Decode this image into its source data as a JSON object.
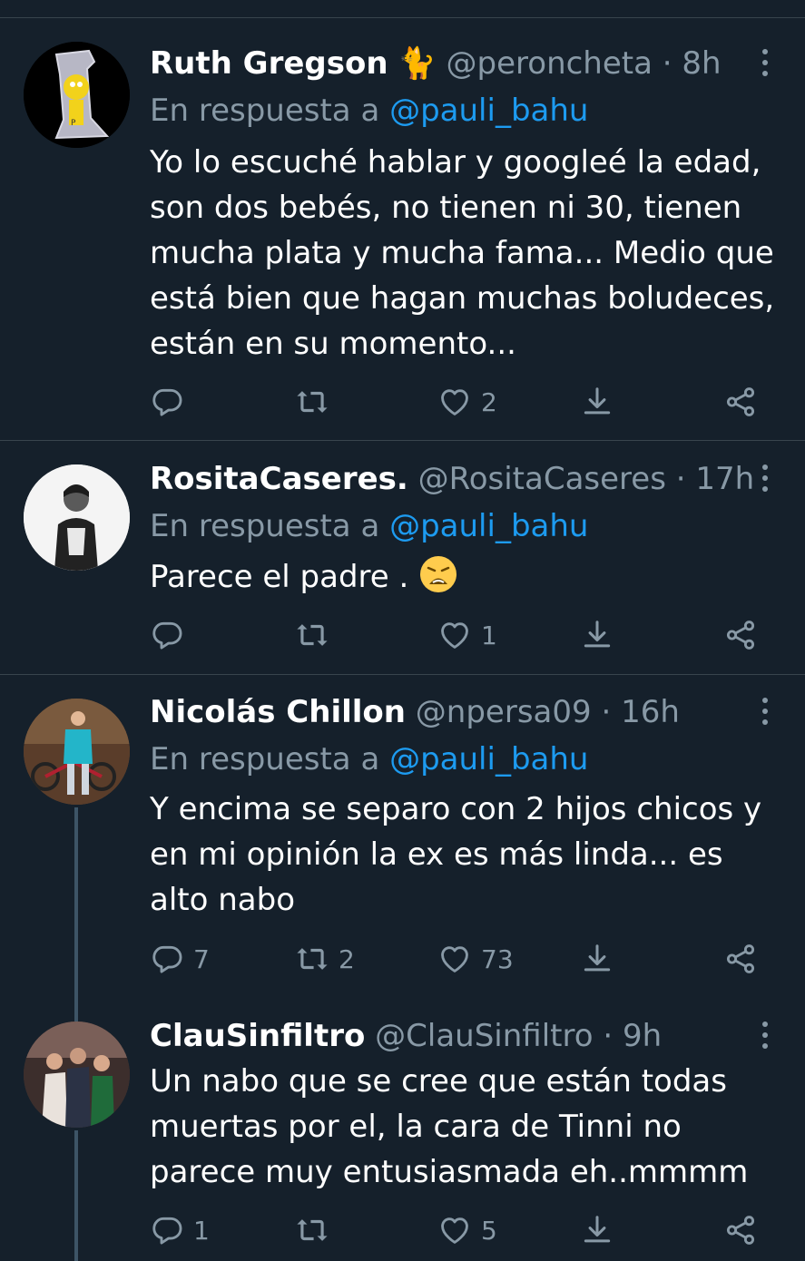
{
  "tweets": [
    {
      "name": "Ruth Gregson",
      "name_emoji": "🐈",
      "handle": "@peroncheta",
      "time": "· 8h",
      "reply_prefix": "En respuesta a",
      "reply_to": "@pauli_bahu",
      "text": "Yo lo escuché hablar y googleé la edad, son dos bebés, no tienen ni 30, tienen mucha plata y mucha fama... Medio que está bien que hagan muchas boludeces, están en su momento...",
      "replies": "",
      "retweets": "",
      "likes": "2"
    },
    {
      "name": "RositaCaseres.",
      "handle": "@RositaCaseres",
      "time": "· 17h",
      "reply_prefix": "En respuesta a",
      "reply_to": "@pauli_bahu",
      "text": "Parece el padre .",
      "text_emoji": "weary-face",
      "replies": "",
      "retweets": "",
      "likes": "1"
    },
    {
      "name": "Nicolás Chillon",
      "handle": "@npersa09",
      "time": "· 16h",
      "reply_prefix": "En respuesta a",
      "reply_to": "@pauli_bahu",
      "text": "Y encima se separo con 2 hijos chicos y en mi opinión la ex es más linda... es alto nabo",
      "replies": "7",
      "retweets": "2",
      "likes": "73"
    },
    {
      "name": "ClauSinfiltro",
      "handle": "@ClauSinfiltro",
      "time": "· 9h",
      "text": "Un nabo que se cree que están todas muertas por el, la cara de Tinni no parece muy entusiasmada eh..mmmm",
      "replies": "1",
      "retweets": "",
      "likes": "5"
    }
  ],
  "colors": {
    "background": "#15202b",
    "secondary": "#8899a6",
    "link": "#1d9bf0",
    "divider": "#38444d"
  },
  "icons": [
    "more-icon",
    "reply-icon",
    "retweet-icon",
    "like-icon",
    "download-icon",
    "share-icon"
  ]
}
